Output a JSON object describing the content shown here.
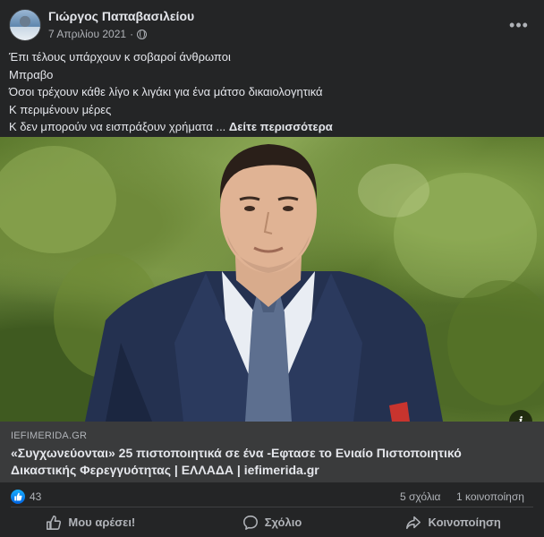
{
  "post": {
    "author": "Γιώργος Παπαβασιλείου",
    "date": "7 Απριλίου 2021",
    "separator": "·",
    "lines": [
      "Έπι τέλους υπάρχουν κ σοβαροί άνθρωποι",
      "Μπραβο",
      "Όσοι τρέχουν κάθε λίγο κ λιγάκι για ένα μάτσο δικαιολογητικά",
      "Κ περιμένουν μέρες",
      "Κ δεν μπορούν να εισπράξουν χρήματα"
    ],
    "ellipsis": " ... ",
    "see_more": "Δείτε περισσότερα"
  },
  "link_preview": {
    "domain": "IEFIMERIDA.GR",
    "headline": "«Συγχωνεύονται» 25 πιστοποιητικά σε ένα -Εφτασε το Ενιαίο Πιστοποιητικό Δικαστικής Φερεγγυότητας | ΕΛΛΑΔΑ | iefimerida.gr"
  },
  "stats": {
    "likes": "43",
    "comments": "5 σχόλια",
    "shares": "1 κοινοποίηση"
  },
  "actions": {
    "like": "Μου αρέσει!",
    "comment": "Σχόλιο",
    "share": "Κοινοποίηση"
  },
  "icons": {
    "more": "more-horizontal-icon",
    "privacy": "globe-icon",
    "info": "info-icon",
    "like_badge": "thumbs-up-icon",
    "like": "thumbs-up-outline-icon",
    "comment": "comment-bubble-icon",
    "share": "share-arrow-icon"
  },
  "colors": {
    "background": "#242526",
    "text": "#e4e6eb",
    "secondary_text": "#b0b3b8",
    "link_box": "#3a3b3c",
    "like_blue": "#1877f2"
  }
}
